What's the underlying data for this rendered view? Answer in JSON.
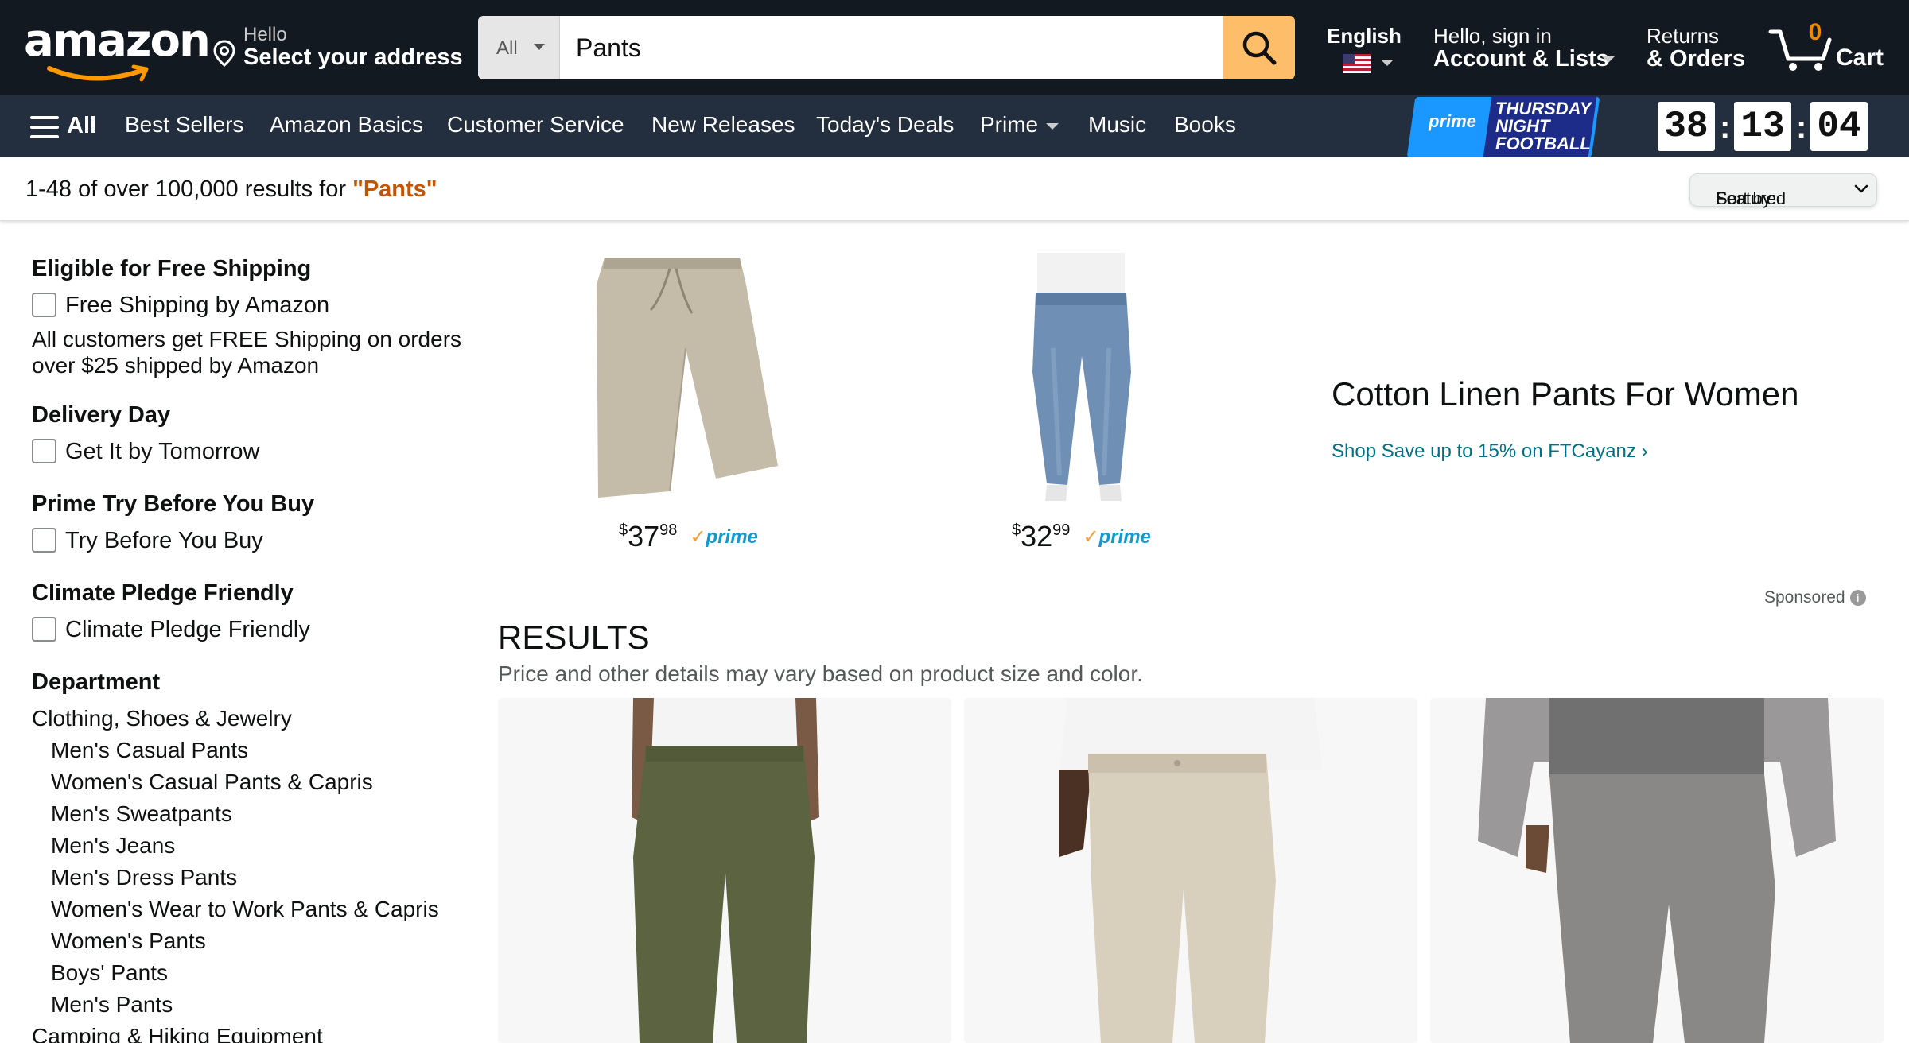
{
  "header": {
    "logo_text": "amazon",
    "address": {
      "line1": "Hello",
      "line2": "Select your address"
    },
    "search": {
      "category": "All",
      "query": "Pants"
    },
    "language": {
      "label": "English"
    },
    "account": {
      "line1": "Hello, sign in",
      "line2": "Account & Lists"
    },
    "orders": {
      "line1": "Returns",
      "line2": "& Orders"
    },
    "cart": {
      "count": "0",
      "label": "Cart"
    }
  },
  "subnav": {
    "all_label": "All",
    "links": [
      "Best Sellers",
      "Amazon Basics",
      "Customer Service",
      "New Releases",
      "Today's Deals",
      "Prime",
      "Music",
      "Books"
    ],
    "promo": {
      "prime_word": "prime",
      "line1": "THURSDAY",
      "line2": "NIGHT",
      "line3": "FOOTBALL"
    },
    "countdown": {
      "hours": "38",
      "minutes": "13",
      "seconds": "04"
    }
  },
  "results_bar": {
    "prefix": "1-48 of over 100,000 results for ",
    "query": "\"Pants\"",
    "sort_label": "Sort by:",
    "sort_value": "Featured"
  },
  "sidebar": {
    "free_shipping": {
      "heading": "Eligible for Free Shipping",
      "option": "Free Shipping by Amazon",
      "note": "All customers get FREE Shipping on orders over $25 shipped by Amazon"
    },
    "delivery": {
      "heading": "Delivery Day",
      "option": "Get It by Tomorrow"
    },
    "try_before": {
      "heading": "Prime Try Before You Buy",
      "option": "Try Before You Buy"
    },
    "climate": {
      "heading": "Climate Pledge Friendly",
      "option": "Climate Pledge Friendly"
    },
    "department": {
      "heading": "Department",
      "top": "Clothing, Shoes & Jewelry",
      "items": [
        "Men's Casual Pants",
        "Women's Casual Pants & Capris",
        "Men's Sweatpants",
        "Men's Jeans",
        "Men's Dress Pants",
        "Women's Wear to Work Pants & Capris",
        "Women's Pants",
        "Boys' Pants",
        "Men's Pants"
      ],
      "next": "Camping & Hiking Equipment"
    }
  },
  "sponsored_banner": {
    "products": [
      {
        "price_dollars": "37",
        "price_cents": "98",
        "currency": "$",
        "prime": "prime"
      },
      {
        "price_dollars": "32",
        "price_cents": "99",
        "currency": "$",
        "prime": "prime"
      }
    ],
    "title": "Cotton Linen Pants For Women",
    "link": "Shop Save up to 15% on FTCayanz ›",
    "sponsored_label": "Sponsored"
  },
  "results": {
    "heading": "RESULTS",
    "subheading": "Price and other details may vary based on product size and color.",
    "cards": [
      {
        "pants_color": "#5b6341",
        "shirt_color": "#f4f4f4"
      },
      {
        "pants_color": "#d9cfbd",
        "shirt_color": "#f4f4f4"
      },
      {
        "pants_color": "#8a8787",
        "shirt_color": "#707070"
      }
    ]
  },
  "colors": {
    "nav_dark": "#131921",
    "nav_sub": "#232f3e",
    "search_button": "#febd69",
    "query_highlight": "#c45500",
    "link": "#007185",
    "prime_blue": "#1399d2"
  }
}
